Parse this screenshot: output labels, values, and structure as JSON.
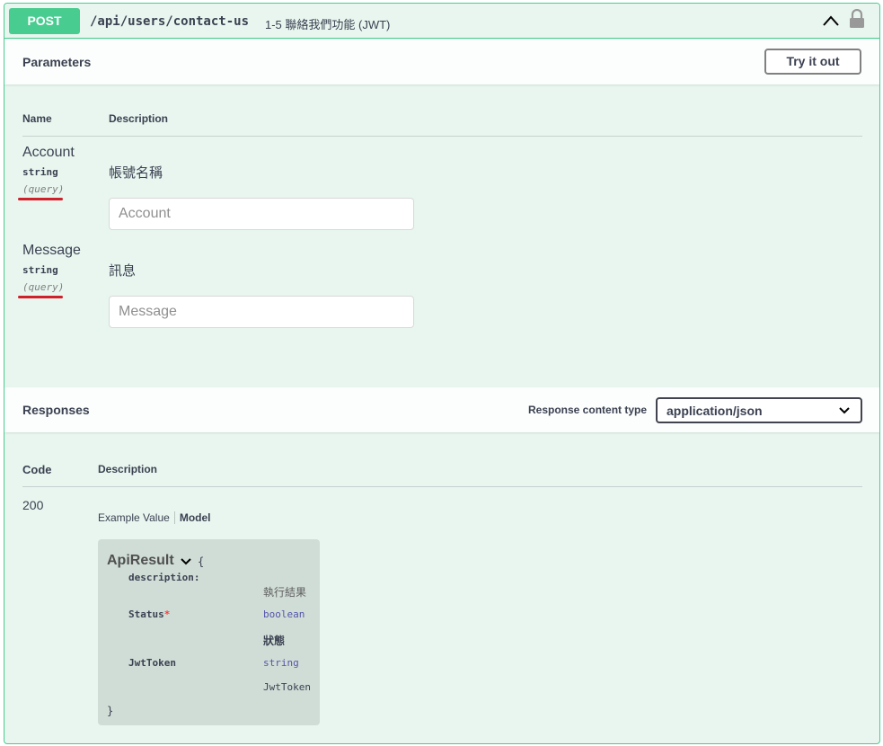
{
  "operation": {
    "method": "POST",
    "path": "/api/users/contact-us",
    "summary": "1-5 聯絡我們功能 (JWT)"
  },
  "parameters": {
    "title": "Parameters",
    "try_it_out_label": "Try it out",
    "columns": {
      "name": "Name",
      "description": "Description"
    },
    "items": [
      {
        "name": "Account",
        "type": "string",
        "in": "(query)",
        "description": "帳號名稱",
        "placeholder": "Account"
      },
      {
        "name": "Message",
        "type": "string",
        "in": "(query)",
        "description": "訊息",
        "placeholder": "Message"
      }
    ]
  },
  "responses": {
    "title": "Responses",
    "content_type_label": "Response content type",
    "content_type_value": "application/json",
    "columns": {
      "code": "Code",
      "description": "Description"
    },
    "items": [
      {
        "code": "200",
        "tabs": {
          "example": "Example Value",
          "model": "Model"
        },
        "model": {
          "name": "ApiResult",
          "open_brace": "{",
          "close_brace": "}",
          "props": [
            {
              "key": "description:",
              "value": "執行結果"
            },
            {
              "key": "Status",
              "required_mark": "*",
              "type": "boolean",
              "description": "狀態"
            },
            {
              "key": "JwtToken",
              "type": "string",
              "description": "JwtToken"
            }
          ]
        }
      }
    ]
  },
  "colors": {
    "post_green": "#49cc90",
    "block_bg": "#e8f6ef",
    "highlight_red": "#d0202a"
  }
}
